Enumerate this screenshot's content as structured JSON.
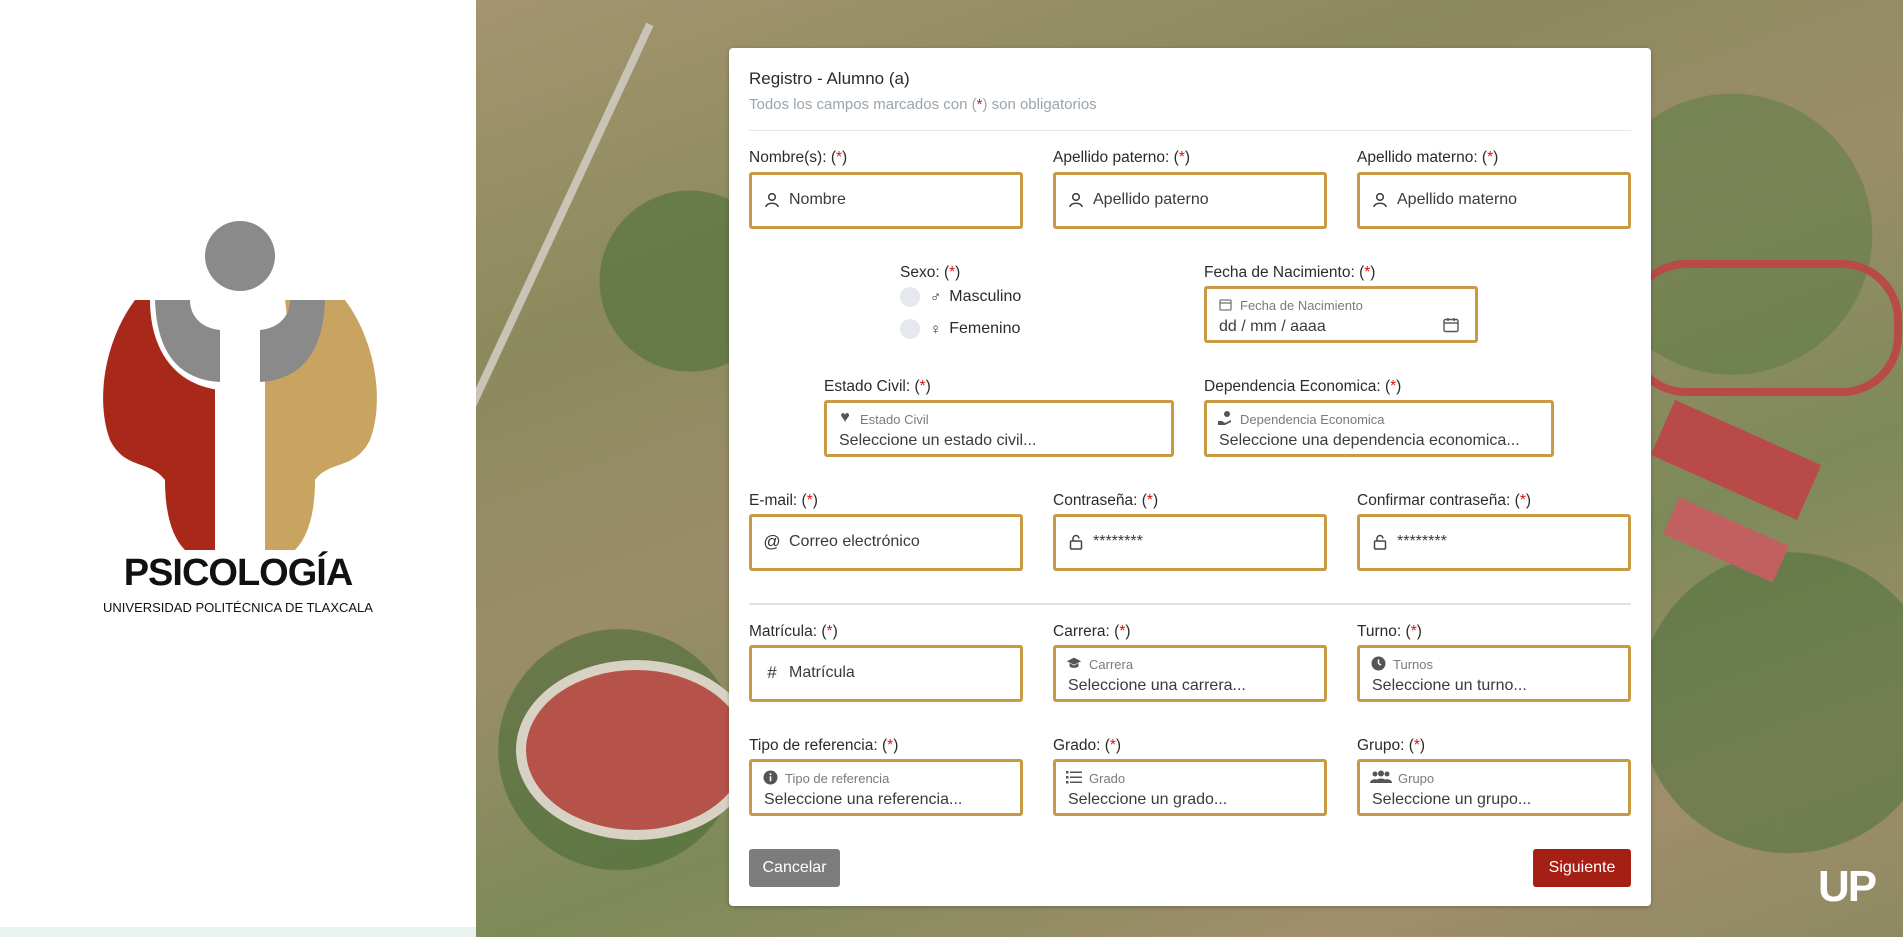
{
  "brand": {
    "title": "PSICOLOGÍA",
    "subtitle": "UNIVERSIDAD POLITÉCNICA DE TLAXCALA",
    "corner_mark": "UP"
  },
  "form": {
    "title": "Registro - Alumno (a)",
    "subtitle_before": "Todos los campos marcados con (",
    "subtitle_star": "*",
    "subtitle_after": ") son obligatorios",
    "required_mark": "*"
  },
  "fields": {
    "nombre": {
      "label": "Nombre(s):",
      "placeholder": "Nombre",
      "icon": "user-icon"
    },
    "apellido_paterno": {
      "label": "Apellido paterno:",
      "placeholder": "Apellido paterno",
      "icon": "user-icon"
    },
    "apellido_materno": {
      "label": "Apellido materno:",
      "placeholder": "Apellido materno",
      "icon": "user-icon"
    },
    "sexo": {
      "label": "Sexo:",
      "options": [
        "Masculino",
        "Femenino"
      ]
    },
    "fecha_nacimiento": {
      "label": "Fecha de Nacimiento:",
      "float_label": "Fecha de Nacimiento",
      "value": "dd / mm / aaaa"
    },
    "estado_civil": {
      "label": "Estado Civil:",
      "float_label": "Estado Civil",
      "value": "Seleccione un estado civil..."
    },
    "dependencia": {
      "label": "Dependencia Economica:",
      "float_label": "Dependencia Economica",
      "value": "Seleccione una dependencia economica..."
    },
    "email": {
      "label": "E-mail:",
      "placeholder": "Correo electrónico"
    },
    "contrasena": {
      "label": "Contraseña:",
      "placeholder": "********"
    },
    "confirmar": {
      "label": "Confirmar contraseña:",
      "placeholder": "********"
    },
    "matricula": {
      "label": "Matrícula:",
      "placeholder": "Matrícula"
    },
    "carrera": {
      "label": "Carrera:",
      "float_label": "Carrera",
      "value": "Seleccione una carrera..."
    },
    "turno": {
      "label": "Turno:",
      "float_label": "Turnos",
      "value": "Seleccione un turno..."
    },
    "referencia": {
      "label": "Tipo de referencia:",
      "float_label": "Tipo de referencia",
      "value": "Seleccione una referencia..."
    },
    "grado": {
      "label": "Grado:",
      "float_label": "Grado",
      "value": "Seleccione un grado..."
    },
    "grupo": {
      "label": "Grupo:",
      "float_label": "Grupo",
      "value": "Seleccione un grupo..."
    }
  },
  "buttons": {
    "cancel": "Cancelar",
    "next": "Siguiente"
  },
  "colors": {
    "accent_border": "#c99a44",
    "primary_button": "#a61f14",
    "secondary_button": "#7c7c7c",
    "required": "#dd1111"
  }
}
